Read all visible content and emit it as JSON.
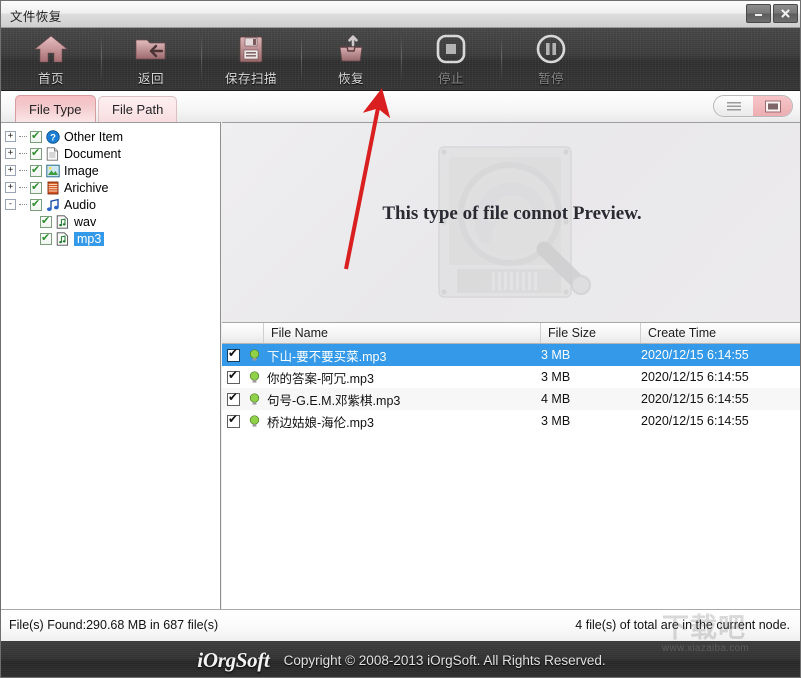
{
  "window": {
    "title": "文件恢复",
    "minimize_label": "—",
    "close_label": "✕"
  },
  "toolbar": {
    "items": [
      {
        "label": "首页",
        "icon": "home-icon",
        "enabled": true
      },
      {
        "label": "返回",
        "icon": "back-folder-icon",
        "enabled": true
      },
      {
        "label": "保存扫描",
        "icon": "floppy-save-icon",
        "enabled": true
      },
      {
        "label": "恢复",
        "icon": "recover-basket-icon",
        "enabled": true
      },
      {
        "label": "停止",
        "icon": "stop-icon",
        "enabled": false
      },
      {
        "label": "暂停",
        "icon": "pause-icon",
        "enabled": false
      }
    ]
  },
  "tabs": {
    "active": "File Type",
    "items": [
      {
        "label": "File Type",
        "active": true
      },
      {
        "label": "File Path",
        "active": false
      }
    ]
  },
  "view_toggle": {
    "list_icon": "list-view-icon",
    "detail_icon": "detail-view-icon",
    "selected": "detail-view-icon"
  },
  "tree": {
    "nodes": [
      {
        "label": "Other Item",
        "icon": "question-blue-icon",
        "expander": "+",
        "checked": true,
        "level": 0,
        "selected": false
      },
      {
        "label": "Document",
        "icon": "document-icon",
        "expander": "+",
        "checked": true,
        "level": 0,
        "selected": false
      },
      {
        "label": "Image",
        "icon": "image-icon",
        "expander": "+",
        "checked": true,
        "level": 0,
        "selected": false
      },
      {
        "label": "Arichive",
        "icon": "archive-icon",
        "expander": "+",
        "checked": true,
        "level": 0,
        "selected": false
      },
      {
        "label": "Audio",
        "icon": "audio-note-icon",
        "expander": "-",
        "checked": true,
        "level": 0,
        "selected": false
      },
      {
        "label": "wav",
        "icon": "audio-file-icon",
        "expander": "",
        "checked": true,
        "level": 1,
        "selected": false
      },
      {
        "label": "mp3",
        "icon": "audio-file-icon",
        "expander": "",
        "checked": true,
        "level": 1,
        "selected": true
      }
    ]
  },
  "preview": {
    "message": "This type of file connot Preview.",
    "art_icon": "harddisk-magnifier-icon"
  },
  "filelist": {
    "columns": [
      "",
      "File Name",
      "File Size",
      "Create Time"
    ],
    "rows": [
      {
        "checked": true,
        "name": "下山-要不要买菜.mp3",
        "size": "3 MB",
        "time": "2020/12/15 6:14:55",
        "selected": true
      },
      {
        "checked": true,
        "name": "你的答案-阿冗.mp3",
        "size": "3 MB",
        "time": "2020/12/15 6:14:55",
        "selected": false
      },
      {
        "checked": true,
        "name": "句号-G.E.M.邓紫棋.mp3",
        "size": "4 MB",
        "time": "2020/12/15 6:14:55",
        "selected": false
      },
      {
        "checked": true,
        "name": "桥边姑娘-海伦.mp3",
        "size": "3 MB",
        "time": "2020/12/15 6:14:55",
        "selected": false
      }
    ]
  },
  "statusbar": {
    "left": "File(s) Found:290.68 MB in 687 file(s)",
    "right": "4 file(s) of total are in the current node."
  },
  "footer": {
    "brand": "iOrgSoft",
    "copyright": "Copyright © 2008-2013 iOrgSoft. All Rights Reserved."
  },
  "watermark": {
    "text_cn": "下载吧",
    "url": "www.xiazaiba.com"
  },
  "annotation": {
    "arrow_color": "#d91f1f"
  },
  "colors": {
    "selection_blue": "#3399e8",
    "tab_pink": "#f3c8cb",
    "toolbar_dark": "#333333",
    "arrow_red": "#d91f1f"
  }
}
